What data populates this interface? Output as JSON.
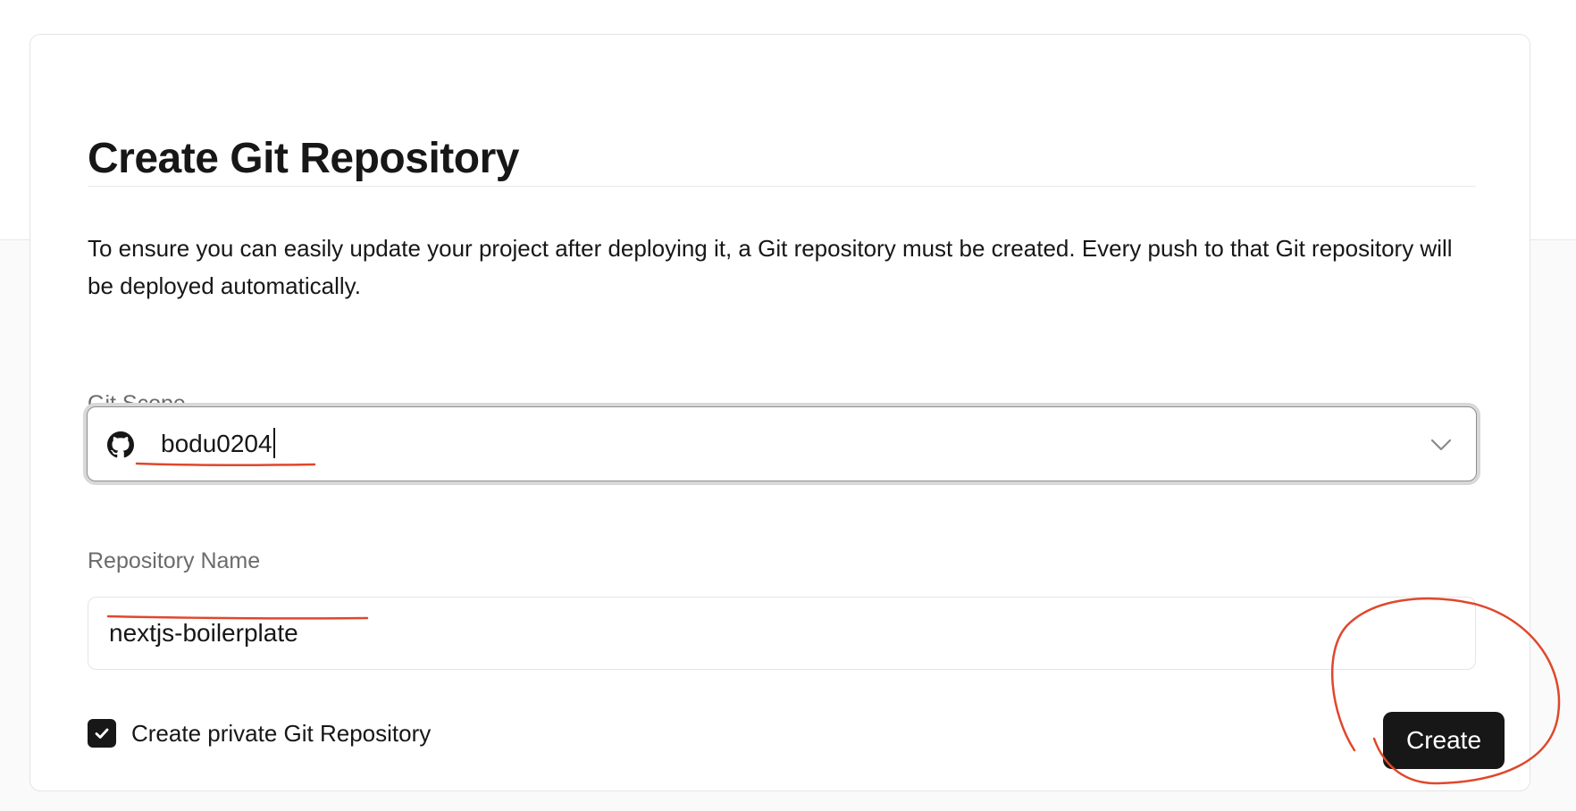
{
  "dialog": {
    "title": "Create Git Repository",
    "description": "To ensure you can easily update your project after deploying it, a Git repository must be created. Every push to that Git repository will be deployed automatically."
  },
  "git_scope": {
    "label": "Git Scope",
    "icon": "github-icon",
    "selected_value": "bodu0204"
  },
  "repository_name": {
    "label": "Repository Name",
    "value": "nextjs-boilerplate"
  },
  "private_repo": {
    "label": "Create private Git Repository",
    "checked": true
  },
  "actions": {
    "create_label": "Create"
  },
  "colors": {
    "primary": "#171717",
    "annotation": "#e0472b",
    "muted_text": "#6b6b6b",
    "border": "#e5e5e5"
  }
}
